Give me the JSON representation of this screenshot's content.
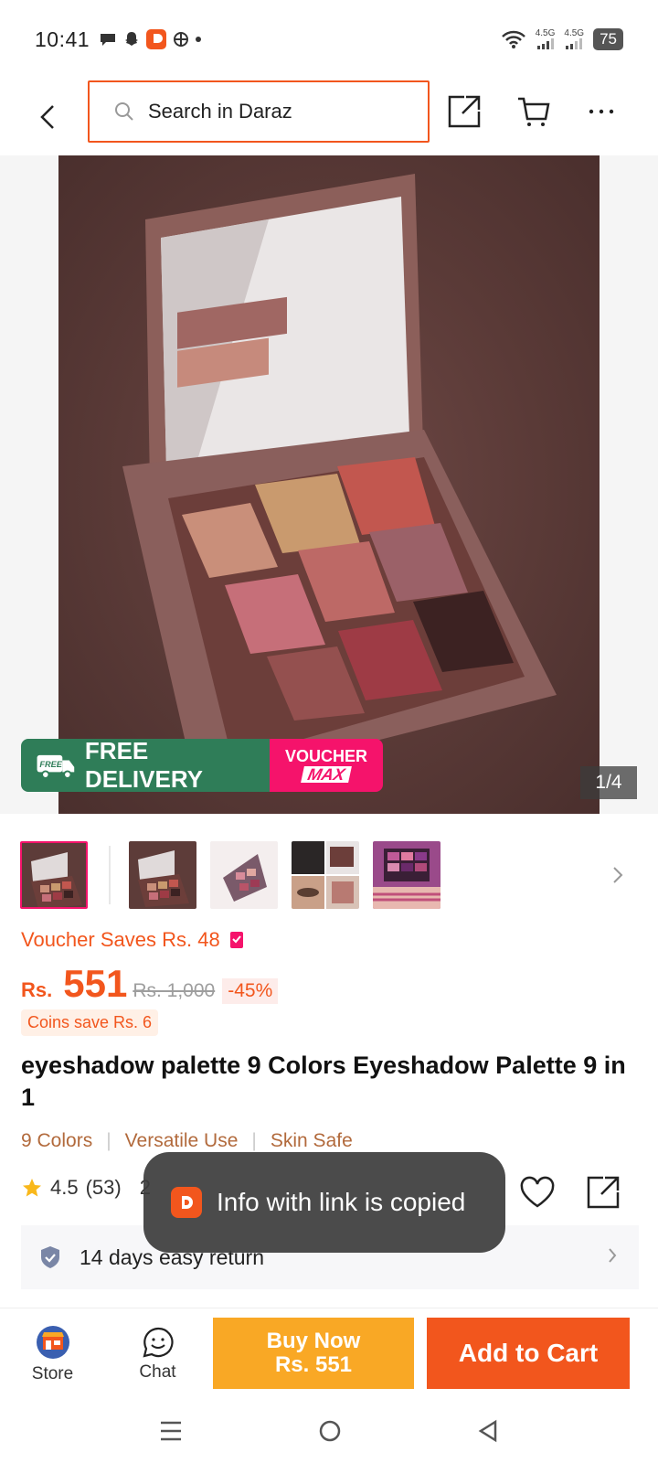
{
  "status_bar": {
    "time": "10:41",
    "signal1": "4.5G",
    "signal2": "4.5G",
    "battery": "75"
  },
  "search": {
    "placeholder": "Search in Daraz"
  },
  "hero": {
    "pager": "1/4",
    "free_delivery": "FREE DELIVERY",
    "free_badge": "FREE",
    "voucher_top": "VOUCHER",
    "voucher_bottom": "MAX"
  },
  "price": {
    "voucher_saves": "Voucher Saves Rs. 48",
    "currency": "Rs.",
    "amount": "551",
    "original": "Rs. 1,000",
    "discount": "-45%",
    "coins": "Coins save Rs. 6"
  },
  "product": {
    "title": "eyeshadow palette 9 Colors Eyeshadow Palette 9 in 1",
    "tags": [
      "9 Colors",
      "Versatile Use",
      "Skin Safe"
    ],
    "rating": "4.5",
    "rating_count": "(53)",
    "sold": "2"
  },
  "return_policy": "14 days easy return",
  "toast": "Info with link is copied",
  "bottom": {
    "store": "Store",
    "chat": "Chat",
    "buy_now_line1": "Buy Now",
    "buy_now_line2": "Rs. 551",
    "add_to_cart": "Add to Cart"
  },
  "colors": {
    "accent": "#f2561d",
    "buy_now": "#f9a825",
    "voucher_pink": "#f5136b",
    "delivery_green": "#2f7d58"
  }
}
